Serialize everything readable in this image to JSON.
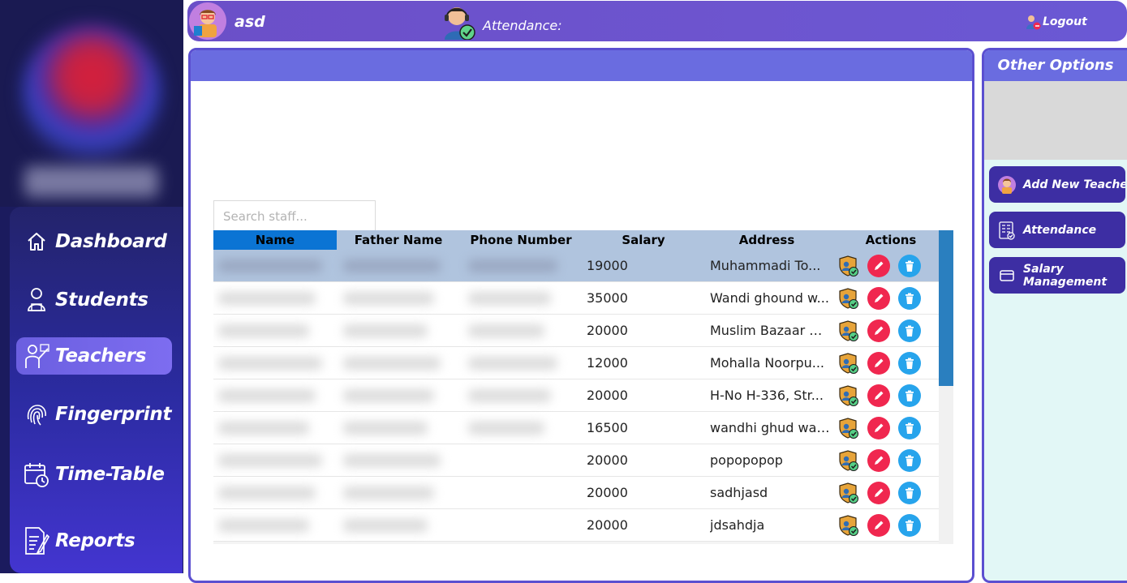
{
  "topbar": {
    "user": "asd",
    "attendance_label": "Attendance:",
    "logout_label": "Logout"
  },
  "nav": {
    "items": [
      {
        "label": "Dashboard",
        "icon": "home-icon"
      },
      {
        "label": "Students",
        "icon": "student-icon"
      },
      {
        "label": "Teachers",
        "icon": "teacher-icon",
        "active": true
      },
      {
        "label": "Fingerprint",
        "icon": "fingerprint-icon"
      },
      {
        "label": "Time-Table",
        "icon": "calendar-clock-icon"
      },
      {
        "label": "Reports",
        "icon": "report-icon"
      }
    ]
  },
  "search": {
    "placeholder": "Search staff..."
  },
  "table": {
    "headers": {
      "name": "Name",
      "father_name": "Father Name",
      "phone": "Phone Number",
      "salary": "Salary",
      "address": "Address",
      "actions": "Actions"
    },
    "rows": [
      {
        "salary": "19000",
        "address": "Muhammadi To..."
      },
      {
        "salary": "35000",
        "address": "Wandi ghound w..."
      },
      {
        "salary": "20000",
        "address": "Muslim Bazaar N..."
      },
      {
        "salary": "12000",
        "address": "Mohalla Noorpu..."
      },
      {
        "salary": "20000",
        "address": "H-No H-336, Str..."
      },
      {
        "salary": "16500",
        "address": "wandhi ghud wal..."
      },
      {
        "salary": "20000",
        "address": "popopopop"
      },
      {
        "salary": "20000",
        "address": "sadhjasd"
      },
      {
        "salary": "20000",
        "address": "jdsahdja"
      }
    ]
  },
  "right_panel": {
    "title": "Other Options",
    "buttons": [
      {
        "label": "Add New Teacher",
        "icon": "teacher-avatar-icon"
      },
      {
        "label": "Attendance",
        "icon": "attendance-sheet-icon"
      },
      {
        "label": "Salary Management",
        "icon": "wallet-icon"
      }
    ]
  },
  "colors": {
    "topbar": "#6b4fc8",
    "sidebar_dark": "#1b1b5e",
    "table_header": "#b0c4de",
    "name_header": "#0b74d4",
    "edit_button": "#f0274f",
    "delete_button": "#27a4ec",
    "panel_header": "#6a6ce0"
  }
}
